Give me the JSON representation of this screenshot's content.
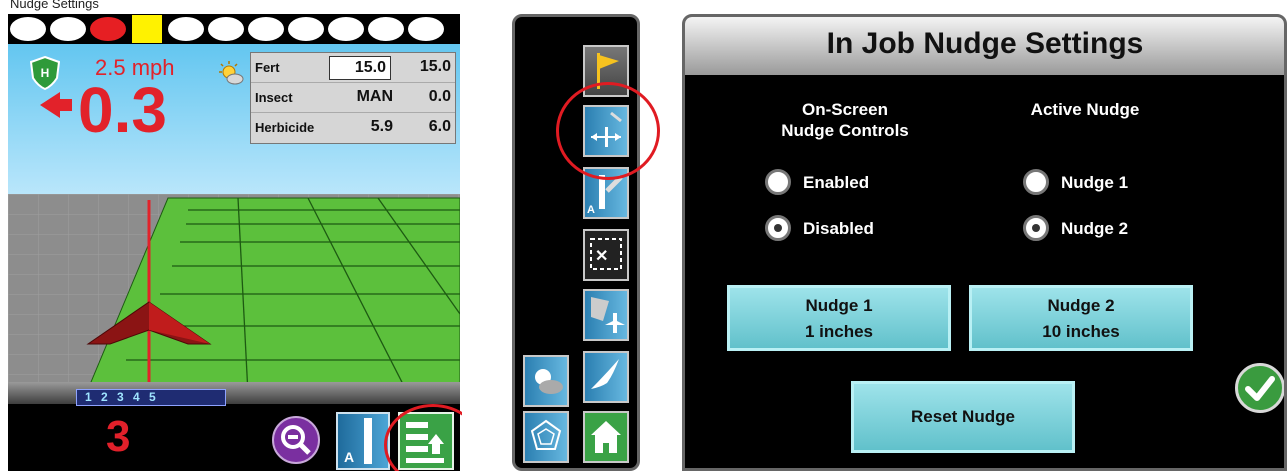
{
  "guidance": {
    "caption": "Nudge Settings",
    "speed": "2.5 mph",
    "cross_track": "0.3",
    "row_selector": "1 2 3 4 5",
    "section_count": "3",
    "products": [
      {
        "name": "Fert",
        "target": "15.0",
        "actual": "15.0"
      },
      {
        "name": "Insect",
        "target": "MAN",
        "actual": "0.0"
      },
      {
        "name": "Herbicide",
        "target": "5.9",
        "actual": "6.0"
      }
    ],
    "icons": [
      "shield-icon",
      "sun-icon",
      "zoom-out-icon",
      "ab-line-icon",
      "nudge-menu-icon"
    ]
  },
  "toolbar": {
    "icons": [
      "flag-icon",
      "nudge-icon",
      "ab-settings-icon",
      "field-mapping-icon",
      "aerial-icon",
      "weather-icon",
      "bird-icon",
      "web-icon",
      "home-icon"
    ]
  },
  "dialog": {
    "title": "In Job Nudge Settings",
    "onscreen_header_line1": "On-Screen",
    "onscreen_header_line2": "Nudge Controls",
    "active_header": "Active Nudge",
    "enabled_label": "Enabled",
    "disabled_label": "Disabled",
    "onscreen_selected": "Disabled",
    "nudge1_label": "Nudge 1",
    "nudge2_label": "Nudge 2",
    "active_selected": "Nudge 2",
    "nudge1_button_title": "Nudge 1",
    "nudge1_button_value": "1  inches",
    "nudge2_button_title": "Nudge 2",
    "nudge2_button_value": "10  inches",
    "reset_label": "Reset Nudge",
    "accept_icon": "checkmark-icon"
  },
  "colors": {
    "highlight_circle": "#e01b22",
    "sky": "#63c6f0",
    "field_green": "#5cc03c",
    "button_cyan": "#7fd2db"
  }
}
